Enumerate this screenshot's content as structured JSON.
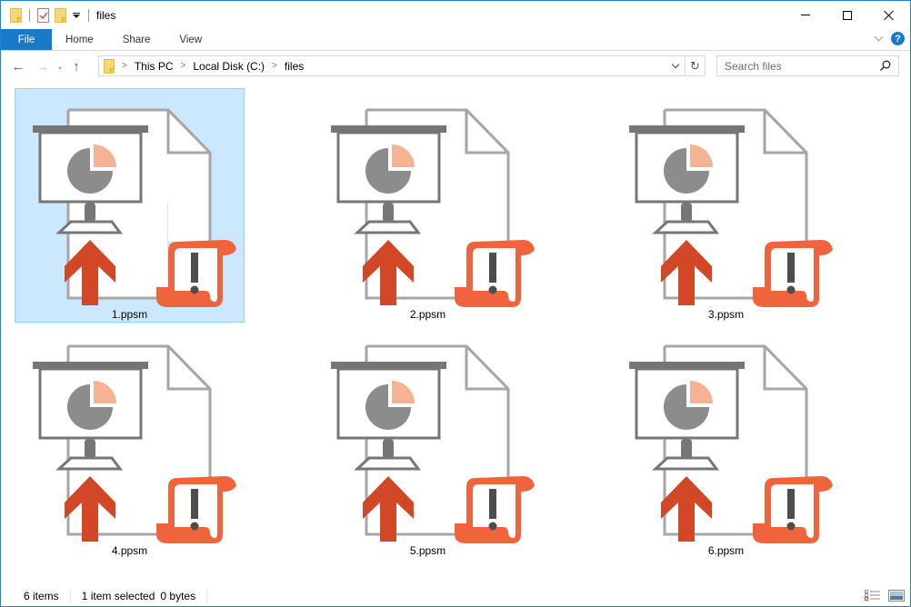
{
  "window": {
    "title": "files",
    "controls": {
      "minimize": "minimize",
      "maximize": "maximize",
      "close": "close"
    }
  },
  "ribbon": {
    "tabs": [
      {
        "label": "File",
        "active": true
      },
      {
        "label": "Home"
      },
      {
        "label": "Share"
      },
      {
        "label": "View"
      }
    ],
    "help": "?"
  },
  "navigation": {
    "back": "←",
    "forward": "→",
    "recent": "⌄",
    "up": "↑",
    "breadcrumb": [
      "This PC",
      "Local Disk (C:)",
      "files"
    ],
    "refresh": "↻",
    "search_placeholder": "Search files"
  },
  "files": [
    {
      "name": "1.ppsm",
      "selected": true
    },
    {
      "name": "2.ppsm",
      "selected": false
    },
    {
      "name": "3.ppsm",
      "selected": false
    },
    {
      "name": "4.ppsm",
      "selected": false
    },
    {
      "name": "5.ppsm",
      "selected": false
    },
    {
      "name": "6.ppsm",
      "selected": false
    }
  ],
  "icon_colors": {
    "arrow": "#d24726",
    "scroll": "#f0643d",
    "pie": "#8c8c8c",
    "pie_slice": "#f4b393",
    "frame": "#767676",
    "page_outline": "#a6a6a6",
    "selection_bg": "#cce8ff",
    "accent": "#1979ca"
  },
  "status": {
    "item_count": "6 items",
    "selected": "1 item selected",
    "size": "0 bytes"
  }
}
